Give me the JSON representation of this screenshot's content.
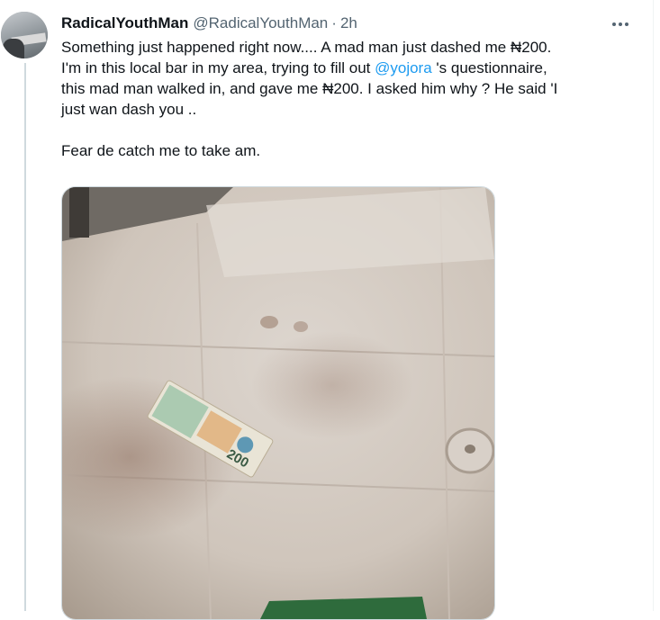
{
  "tweet": {
    "display_name": "RadicalYouthMan",
    "handle": "@RadicalYouthMan",
    "separator": "·",
    "timestamp": "2h",
    "more_label": "•••",
    "text_line1": "Something just happened right now.... A mad man just dashed me ₦200.",
    "text_line2_before": "I'm in this local bar in my area, trying to fill out ",
    "mention": "@yojora",
    "text_line2_after": " 's questionnaire,",
    "text_line3": "this mad man walked in, and gave me ₦200. I asked him why ? He said 'I",
    "text_line4": "just wan dash you ..",
    "text_line5": "Fear de catch me to take am.",
    "media": {
      "description": "photo",
      "banknote_text": "200"
    }
  },
  "colors": {
    "link": "#1d9bf0",
    "secondary_text": "#536471",
    "primary_text": "#0f1419",
    "border": "#cfd9de"
  }
}
